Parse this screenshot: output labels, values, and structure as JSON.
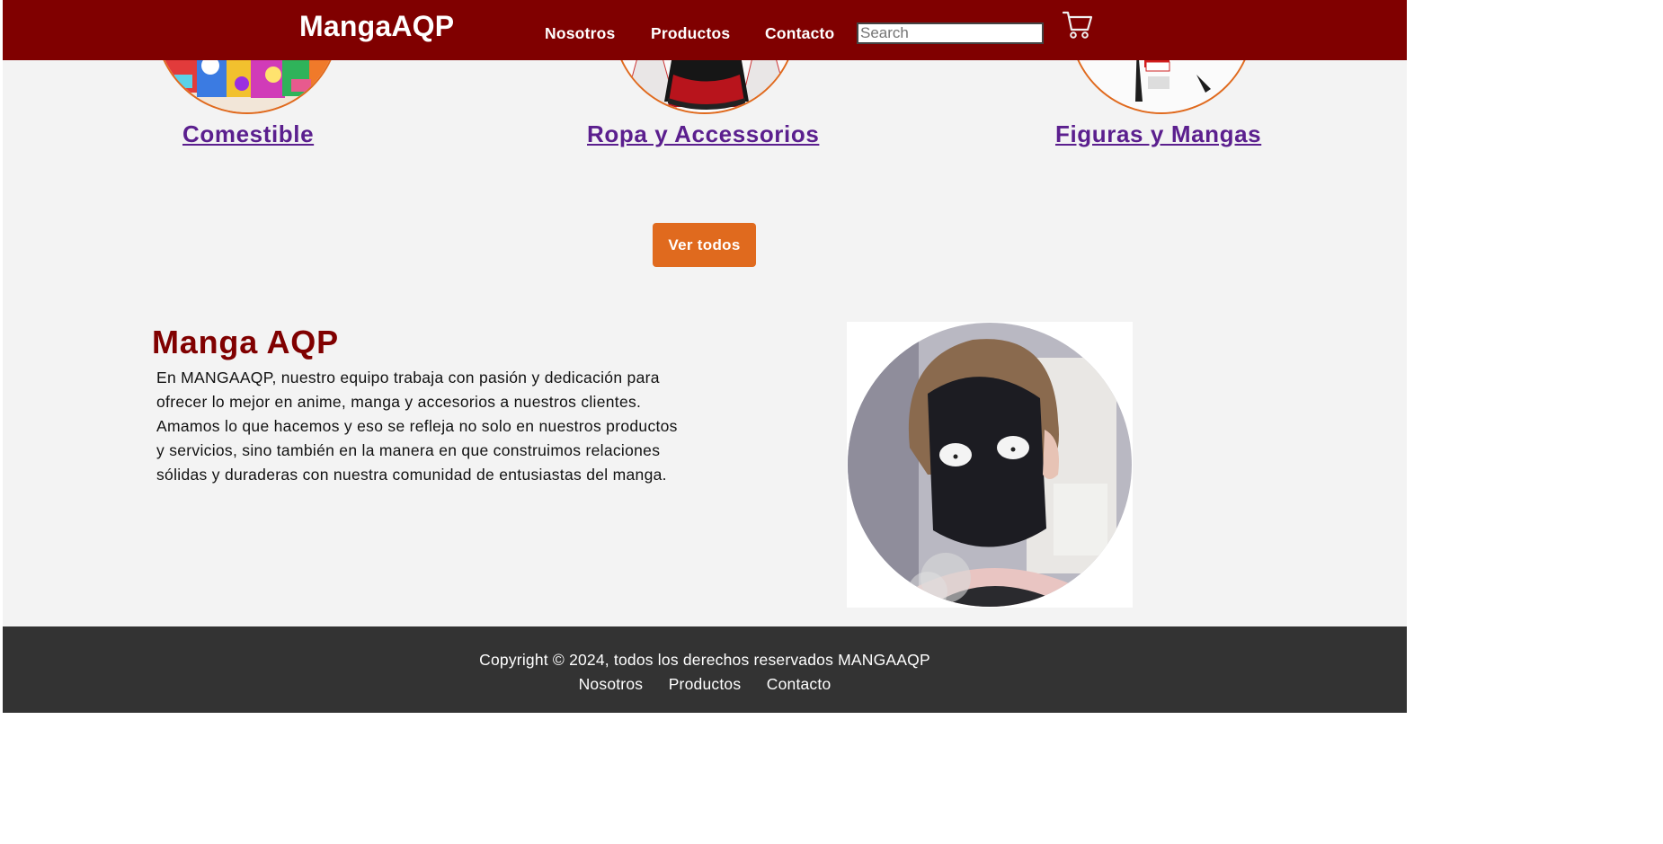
{
  "header": {
    "logo": "MangaAQP",
    "nav": [
      "Nosotros",
      "Productos",
      "Contacto"
    ],
    "search_placeholder": "Search",
    "cart_icon": "shopping-cart-icon"
  },
  "categories": [
    {
      "label": "Comestible",
      "image": "snacks-image"
    },
    {
      "label": "Ropa y Accessorios",
      "image": "clothing-image"
    },
    {
      "label": "Figuras y Mangas",
      "image": "figure-image"
    }
  ],
  "cta": {
    "label": "Ver todos"
  },
  "about": {
    "title": "Manga AQP",
    "text": "En MANGAAQP, nuestro equipo trabaja con pasión y dedicación para ofrecer lo mejor en anime, manga y accesorios a nuestros clientes. Amamos lo que hacemos y eso se refleja no solo en nuestros productos y servicios, sino también en la manera en que construimos relaciones sólidas y duraderas con nuestra comunidad de entusiastas del manga.",
    "image": "masked-character-image"
  },
  "footer": {
    "copyright": "Copyright © 2024, todos los derechos reservados MANGAAQP",
    "links": [
      "Nosotros",
      "Productos",
      "Contacto"
    ]
  },
  "colors": {
    "header_bg": "#800000",
    "accent": "#e06a1e",
    "link": "#5b1f8e",
    "footer_bg": "#333333",
    "page_bg": "#f3f3f3"
  }
}
